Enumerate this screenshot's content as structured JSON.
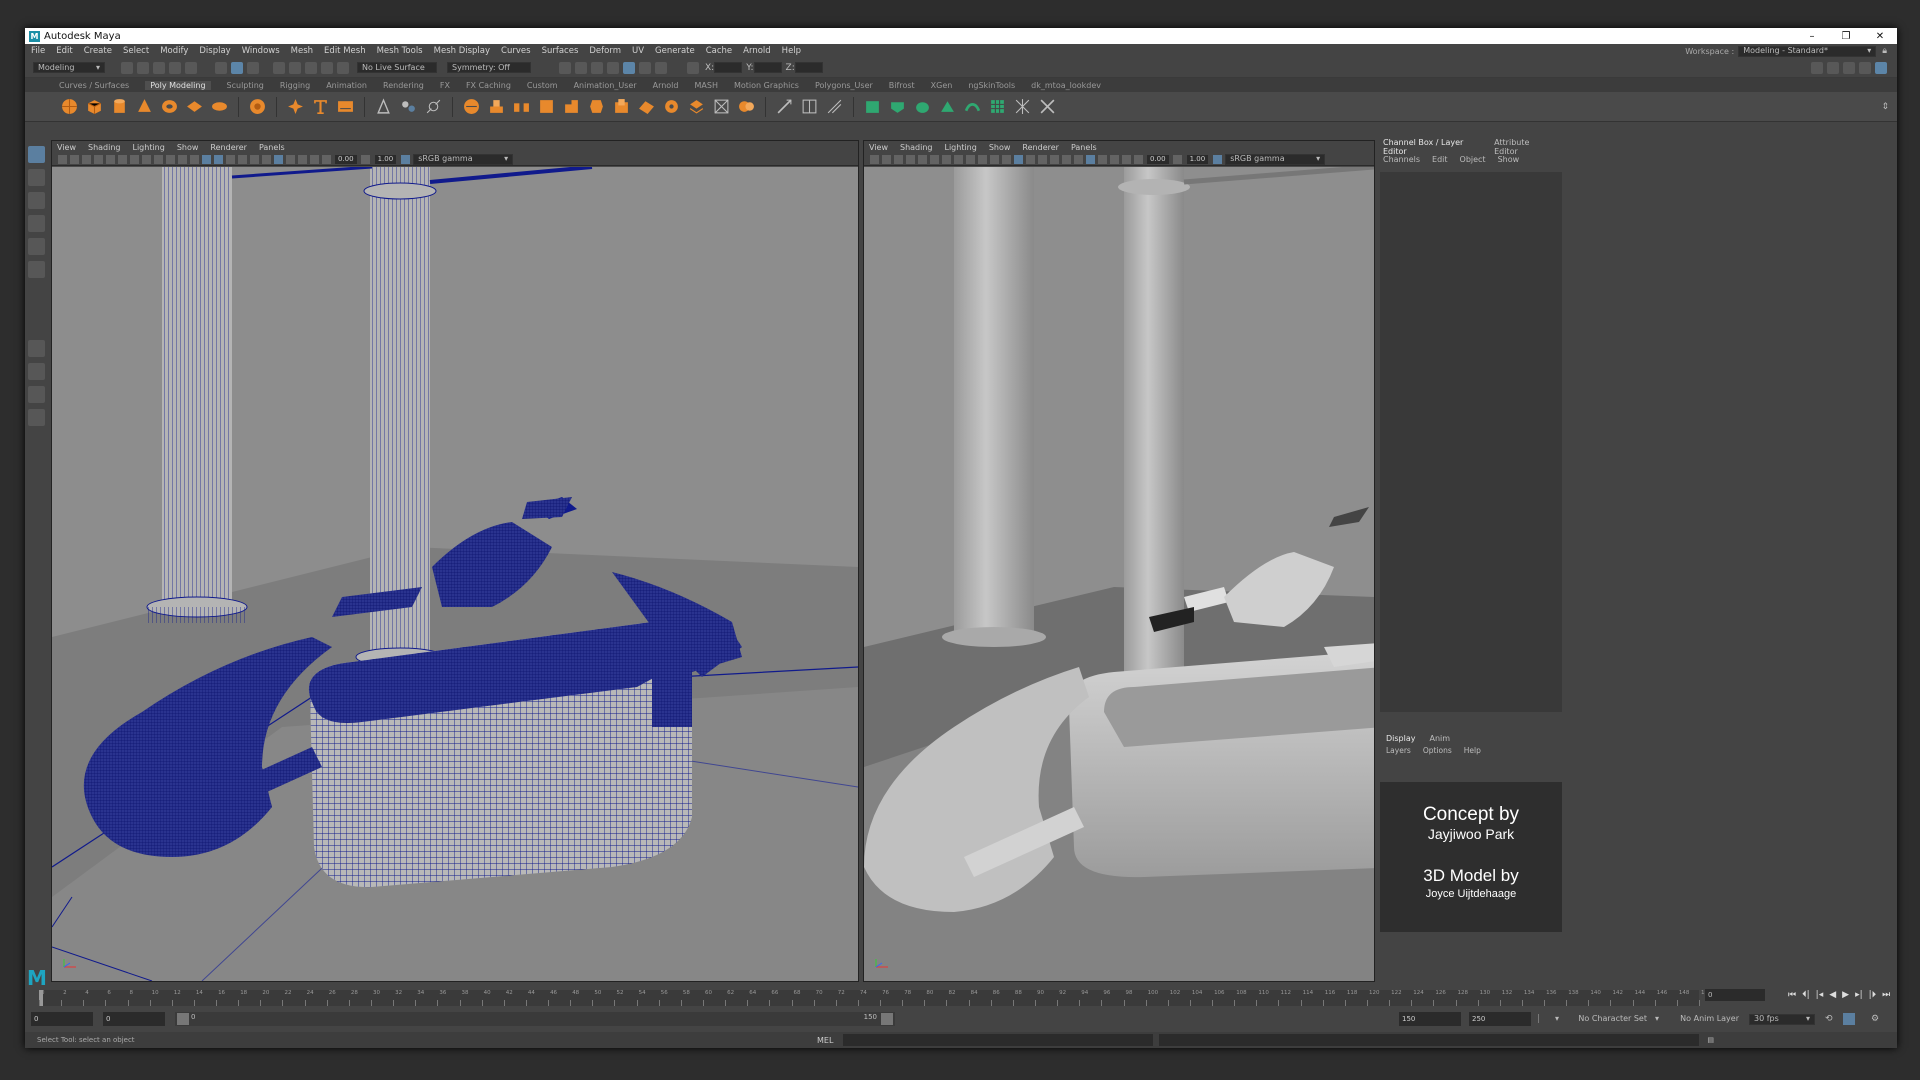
{
  "window": {
    "title": "Autodesk Maya",
    "min": "–",
    "max": "❐",
    "close": "✕"
  },
  "menus": [
    "File",
    "Edit",
    "Create",
    "Select",
    "Modify",
    "Display",
    "Windows",
    "Mesh",
    "Edit Mesh",
    "Mesh Tools",
    "Mesh Display",
    "Curves",
    "Surfaces",
    "Deform",
    "UV",
    "Generate",
    "Cache",
    "Arnold",
    "Help"
  ],
  "workspace": {
    "label": "Workspace :",
    "value": "Modeling - Standard*"
  },
  "statusline": {
    "mode": "Modeling",
    "live_surface": "No Live Surface",
    "symmetry": "Symmetry: Off",
    "x_label": "X:",
    "y_label": "Y:",
    "z_label": "Z:"
  },
  "shelf_tabs": [
    "Curves / Surfaces",
    "Poly Modeling",
    "Sculpting",
    "Rigging",
    "Animation",
    "Rendering",
    "FX",
    "FX Caching",
    "Custom",
    "Animation_User",
    "Arnold",
    "MASH",
    "Motion Graphics",
    "Polygons_User",
    "Bifrost",
    "XGen",
    "ngSkinTools",
    "dk_mtoa_lookdev"
  ],
  "shelf_active": "Poly Modeling",
  "viewport_left": {
    "menus": [
      "View",
      "Shading",
      "Lighting",
      "Show",
      "Renderer",
      "Panels"
    ],
    "exposure": "0.00",
    "gamma": "1.00",
    "color_space": "sRGB gamma"
  },
  "viewport_right": {
    "menus": [
      "View",
      "Shading",
      "Lighting",
      "Show",
      "Renderer",
      "Panels"
    ],
    "exposure": "0.00",
    "gamma": "1.00",
    "color_space": "sRGB gamma"
  },
  "channel_box": {
    "tabs": [
      "Channel Box / Layer Editor",
      "Attribute Editor"
    ],
    "menus": [
      "Channels",
      "Edit",
      "Object",
      "Show"
    ]
  },
  "layer_editor": {
    "tabs": [
      "Display",
      "Anim"
    ],
    "menus": [
      "Layers",
      "Options",
      "Help"
    ]
  },
  "credits": {
    "line1": "Concept by",
    "line2": "Jayjiwoo Park",
    "line3": "3D Model by",
    "line4": "Joyce Uijtdehaage"
  },
  "timeline": {
    "ticks": [
      "0",
      "2",
      "4",
      "6",
      "8",
      "10",
      "12",
      "14",
      "16",
      "18",
      "20",
      "22",
      "24",
      "26",
      "28",
      "30",
      "32",
      "34",
      "36",
      "38",
      "40",
      "42",
      "44",
      "46",
      "48",
      "50",
      "52",
      "54",
      "56",
      "58",
      "60",
      "62",
      "64",
      "66",
      "68",
      "70",
      "72",
      "74",
      "76",
      "78",
      "80",
      "82",
      "84",
      "86",
      "88",
      "90",
      "92",
      "94",
      "96",
      "98",
      "100",
      "102",
      "104",
      "106",
      "108",
      "110",
      "112",
      "114",
      "116",
      "118",
      "120",
      "122",
      "124",
      "126",
      "128",
      "130",
      "132",
      "134",
      "136",
      "138",
      "140",
      "142",
      "144",
      "146",
      "148",
      "150"
    ],
    "current_frame": "0"
  },
  "range": {
    "start": "0",
    "anim_start": "0",
    "range_start_label": "0",
    "range_end_label": "150",
    "end": "150",
    "anim_end": "250",
    "character_set": "No Character Set",
    "anim_layer": "No Anim Layer",
    "fps": "30 fps"
  },
  "help_line": "Select Tool: select an object",
  "command": {
    "lang": "MEL"
  },
  "colors": {
    "wire": "#101a8c",
    "viewport_bg": "#8a8a8a",
    "floor": "#7a7a7a",
    "accent": "#5b7fa0",
    "shelf_icon": "#e8892c"
  }
}
